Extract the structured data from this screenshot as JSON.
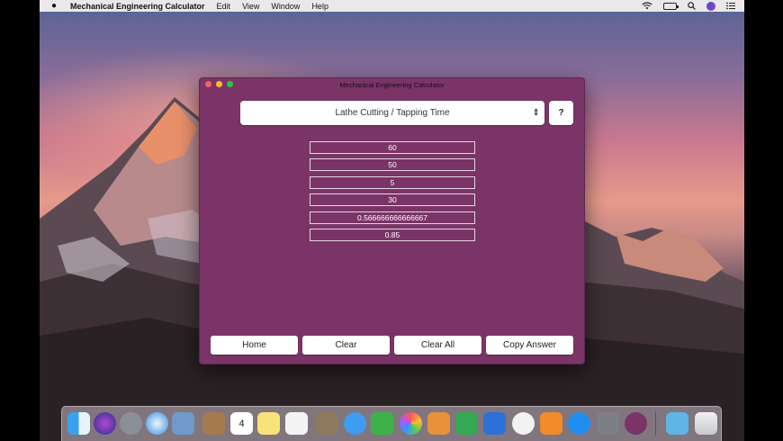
{
  "menubar": {
    "app_name": "Mechanical Engineering Calculator",
    "menus": [
      "Edit",
      "View",
      "Window",
      "Help"
    ]
  },
  "window": {
    "title": "Mechanical Engineering Calculator",
    "calculator_select": {
      "value": "Lathe Cutting / Tapping Time"
    },
    "help_label": "?",
    "fields": [
      "60",
      "50",
      "5",
      "30",
      "0.566666666666667",
      "0.85"
    ],
    "buttons": {
      "home": "Home",
      "clear": "Clear",
      "clear_all": "Clear All",
      "copy_answer": "Copy Answer"
    }
  },
  "colors": {
    "window_bg": "#7a3467",
    "field_border": "#e6d6e2"
  },
  "dock": {
    "icons": [
      "finder-icon",
      "siri-icon",
      "launchpad-icon",
      "safari-icon",
      "mail-icon",
      "contacts-icon",
      "calendar-icon",
      "notes-icon",
      "reminders-icon",
      "photo-booth-icon",
      "messages-icon",
      "facetime-icon",
      "photos-icon",
      "pages-icon",
      "numbers-icon",
      "keynote-icon",
      "itunes-icon",
      "ibooks-icon",
      "app-store-icon",
      "system-preferences-icon",
      "mechanical-calculator-icon",
      "downloads-folder-icon",
      "trash-icon"
    ],
    "calendar_day": "4"
  }
}
